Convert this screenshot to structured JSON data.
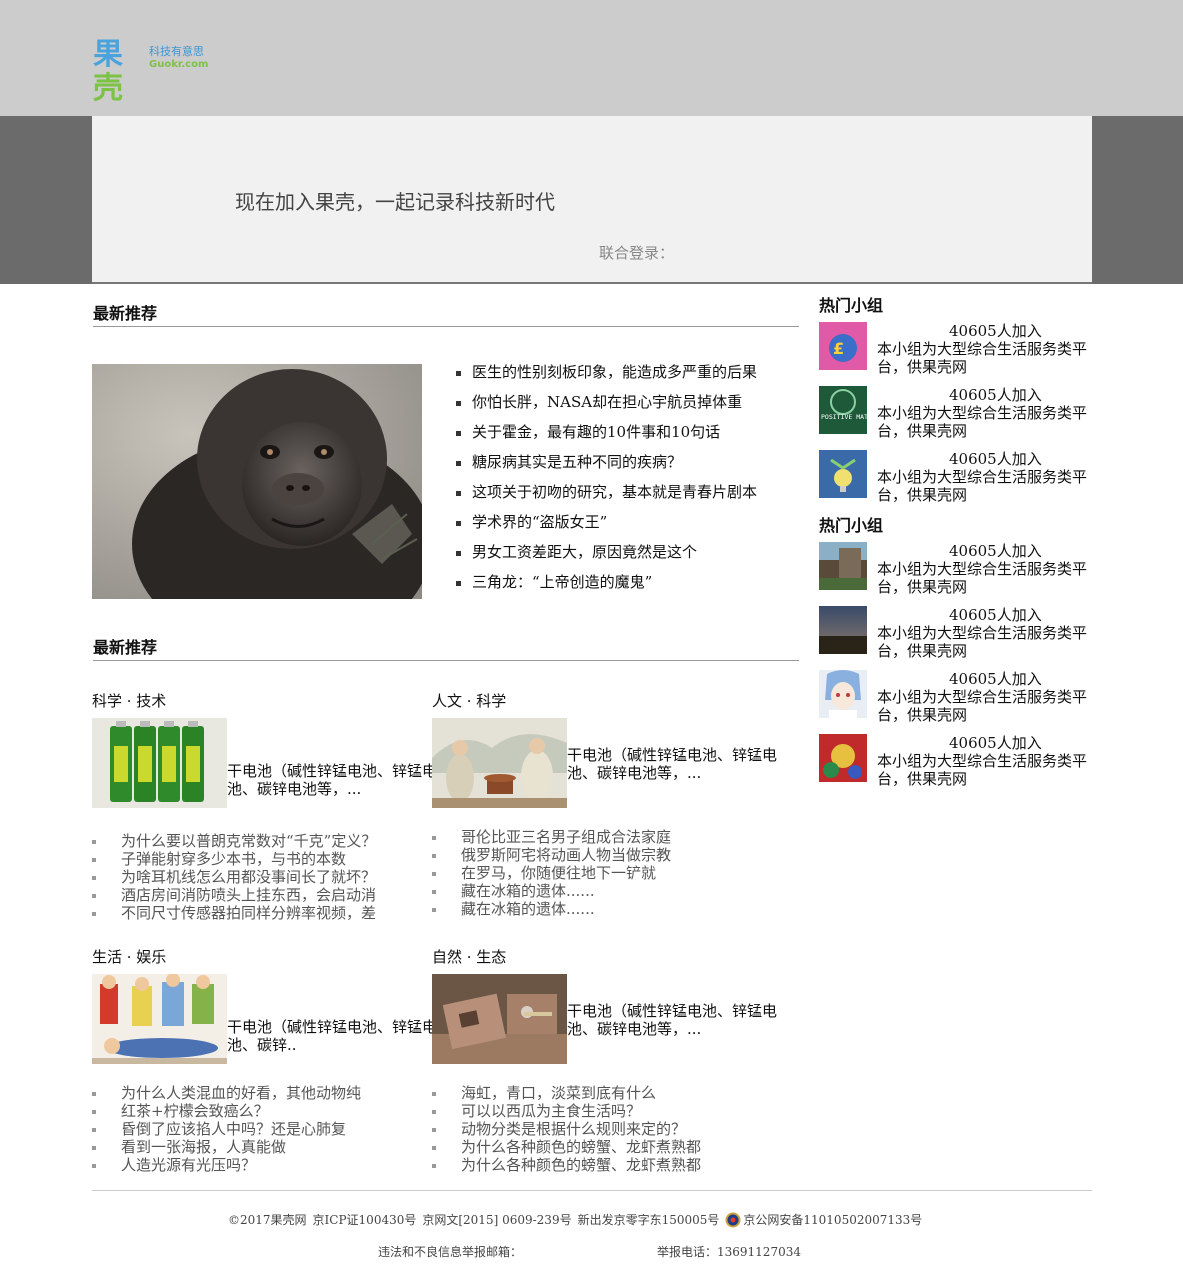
{
  "header": {
    "logo_text_1": "果",
    "logo_text_2": "壳",
    "logo_slogan": "科技有意思",
    "logo_domain": "Guokr.com"
  },
  "banner": {
    "title": "现在加入果壳，一起记录科技新时代",
    "login_label": "联合登录："
  },
  "latest": {
    "title": "最新推荐",
    "items": [
      "医生的性别刻板印象，能造成多严重的后果",
      "你怕长胖，NASA却在担心宇航员掉体重",
      "关于霍金，最有趣的10件事和10句话",
      "糖尿病其实是五种不同的疾病？",
      "这项关于初吻的研究，基本就是青春片剧本",
      "学术界的“盗版女王”",
      "男女工资差距大，原因竟然是这个",
      "三角龙：“上帝创造的魔鬼”"
    ]
  },
  "categories_section": {
    "title": "最新推荐",
    "categories": [
      {
        "name": "科学 · 技术",
        "desc": "干电池（碱性锌锰电池、锌锰电池、碳锌电池等，...",
        "items": [
          "为什么要以普朗克常数对“千克”定义？",
          "子弹能射穿多少本书，与书的本数",
          "为啥耳机线怎么用都没事间长了就坏？",
          "酒店房间消防喷头上挂东西，会启动消",
          "不同尺寸传感器拍同样分辨率视频，差"
        ]
      },
      {
        "name": "人文 · 科学",
        "desc": "干电池（碱性锌锰电池、锌锰电池、碳锌电池等，...",
        "items": [
          "哥伦比亚三名男子组成合法家庭",
          "俄罗斯阿宅将动画人物当做宗教",
          "在罗马，你随便往地下一铲就",
          "藏在冰箱的遗体......",
          "藏在冰箱的遗体......"
        ]
      },
      {
        "name": "生活 · 娱乐",
        "desc": "干电池（碱性锌锰电池、锌锰电池、碳锌..",
        "items": [
          "为什么人类混血的好看，其他动物纯",
          "红茶+柠檬会致癌么？",
          "昏倒了应该掐人中吗？还是心肺复",
          "看到一张海报，人真能做",
          "人造光源有光压吗？"
        ]
      },
      {
        "name": "自然 · 生态",
        "desc": "干电池（碱性锌锰电池、锌锰电池、碳锌电池等，...",
        "items": [
          "海虹，青口，淡菜到底有什么",
          "可以以西瓜为主食生活吗？",
          "动物分类是根据什么规则来定的？",
          "为什么各种颜色的螃蟹、龙虾煮熟都",
          "为什么各种颜色的螃蟹、龙虾煮熟都"
        ]
      }
    ]
  },
  "sidebar": {
    "sections": [
      {
        "title": "热门小组",
        "groups": [
          {
            "count": "40605人加入",
            "desc": "本小组为大型综合生活服务类平台，供果壳网"
          },
          {
            "count": "40605人加入",
            "desc": "本小组为大型综合生活服务类平台，供果壳网"
          },
          {
            "count": "40605人加入",
            "desc": "本小组为大型综合生活服务类平台，供果壳网"
          }
        ]
      },
      {
        "title": "热门小组",
        "groups": [
          {
            "count": "40605人加入",
            "desc": "本小组为大型综合生活服务类平台，供果壳网"
          },
          {
            "count": "40605人加入",
            "desc": "本小组为大型综合生活服务类平台，供果壳网"
          },
          {
            "count": "40605人加入",
            "desc": "本小组为大型综合生活服务类平台，供果壳网"
          },
          {
            "count": "40605人加入",
            "desc": "本小组为大型综合生活服务类平台，供果壳网"
          }
        ]
      }
    ],
    "thumb_1_text": "POSITIVE MATCH"
  },
  "footer": {
    "copyright": "©2017果壳网",
    "icp": "京ICP证100430号",
    "wenwang": "京网文[2015] 0609-239号",
    "publish": "新出发京零字东150005号",
    "police": "京公网安备11010502007133号",
    "report_email_label": "违法和不良信息举报邮箱：",
    "report_phone": "举报电话：13691127034"
  }
}
